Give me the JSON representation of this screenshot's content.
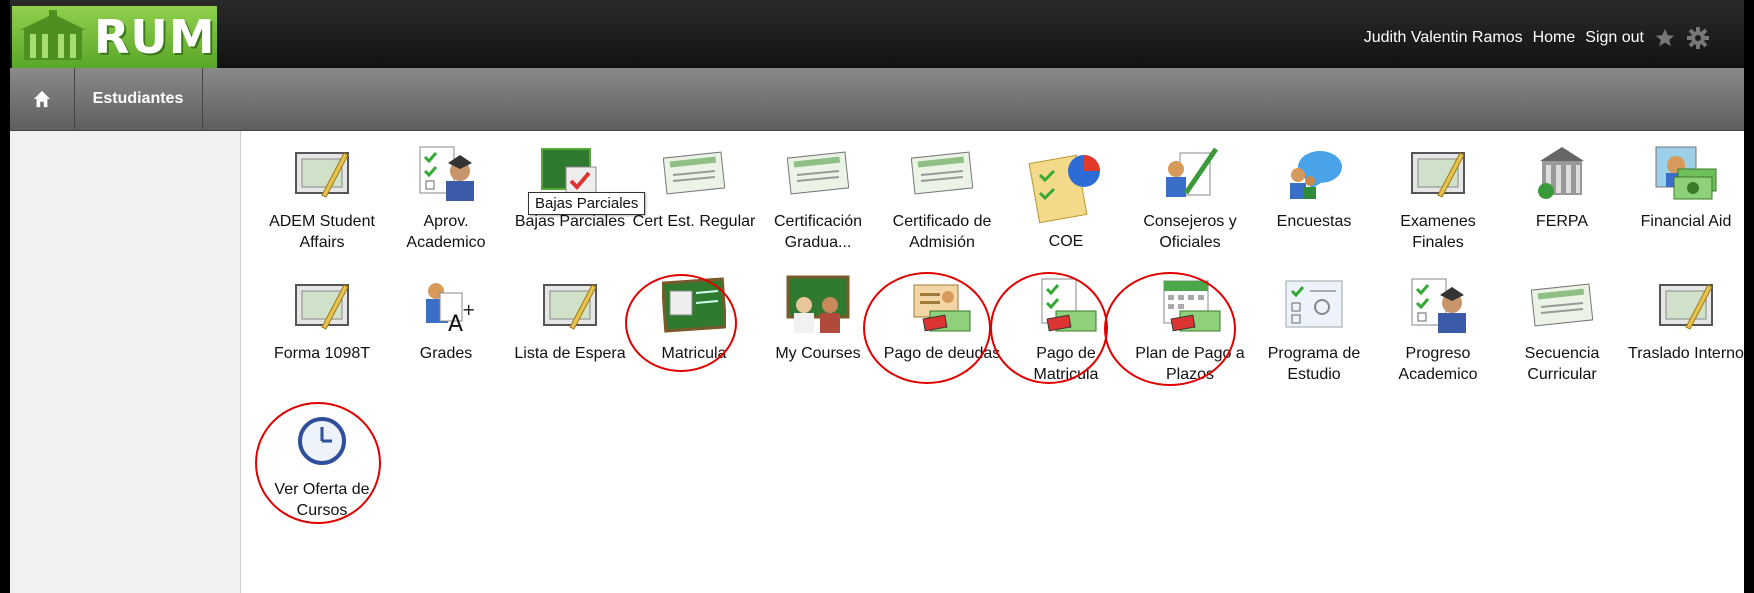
{
  "logo": {
    "text": "RUM"
  },
  "user_bar": {
    "user_name": "Judith Valentin Ramos",
    "home_label": "Home",
    "signout_label": "Sign out"
  },
  "nav": {
    "tab_label": "Estudiantes"
  },
  "tooltip": "Bajas Parciales",
  "tiles": [
    {
      "label": "ADEM Student Affairs",
      "icon": "certificate-pencil-icon"
    },
    {
      "label": "Aprov. Academico",
      "icon": "student-checklist-icon"
    },
    {
      "label": "Bajas Parciales",
      "icon": "chalkboard-check-icon"
    },
    {
      "label": "Cert Est. Regular",
      "icon": "certificate-icon"
    },
    {
      "label": "Certificación Gradua...",
      "icon": "certificate-icon"
    },
    {
      "label": "Certificado de Admisión",
      "icon": "certificate-icon"
    },
    {
      "label": "COE",
      "icon": "chart-document-icon"
    },
    {
      "label": "Consejeros y Oficiales",
      "icon": "counselor-icon"
    },
    {
      "label": "Encuestas",
      "icon": "survey-chat-icon"
    },
    {
      "label": "Examenes Finales",
      "icon": "certificate-pencil-icon"
    },
    {
      "label": "FERPA",
      "icon": "building-icon"
    },
    {
      "label": "Financial Aid",
      "icon": "money-student-icon"
    },
    {
      "label": "Forma 1098T",
      "icon": "certificate-pencil-icon"
    },
    {
      "label": "Grades",
      "icon": "grade-a-plus-icon"
    },
    {
      "label": "Lista de Espera",
      "icon": "certificate-pencil-icon"
    },
    {
      "label": "Matricula",
      "icon": "chalkboard-course-icon"
    },
    {
      "label": "My Courses",
      "icon": "teachers-chalkboard-icon"
    },
    {
      "label": "Pago de deudas",
      "icon": "id-card-money-icon"
    },
    {
      "label": "Pago de Matricula",
      "icon": "checklist-money-icon"
    },
    {
      "label": "Plan de Pago a Plazos",
      "icon": "calendar-money-icon"
    },
    {
      "label": "Programa de Estudio",
      "icon": "certificate-checklist-icon"
    },
    {
      "label": "Progreso Academico",
      "icon": "student-checklist-icon"
    },
    {
      "label": "Secuencia Curricular",
      "icon": "certificate-icon"
    },
    {
      "label": "Traslado Interno",
      "icon": "certificate-pencil-icon"
    },
    {
      "label": "Ver Oferta de Cursos",
      "icon": "clock-icon"
    }
  ],
  "colors": {
    "logo_green": "#6ab82f",
    "annotation_red": "#e00000",
    "topbar": "#1a1a1a",
    "navbar": "#6e6e6e"
  }
}
